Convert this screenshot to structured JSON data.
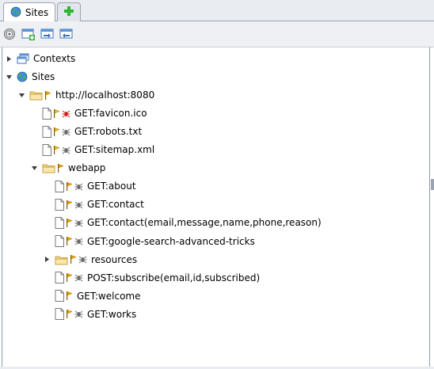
{
  "tabs": [
    {
      "label": "Sites",
      "icon": "globe-icon",
      "selected": true
    },
    {
      "label": "",
      "icon": "plus-icon",
      "selected": false
    }
  ],
  "toolbar": {
    "buttons": [
      {
        "icon": "target-icon"
      },
      {
        "icon": "new-context-icon"
      },
      {
        "icon": "import-context-icon"
      },
      {
        "icon": "export-context-icon"
      }
    ]
  },
  "tree": [
    {
      "label": "Contexts",
      "icon": "contexts-icon",
      "level": 0,
      "toggle": "collapsed"
    },
    {
      "label": "Sites",
      "icon": "globe-icon",
      "level": 0,
      "toggle": "expanded"
    },
    {
      "label": "http://localhost:8080",
      "icon": "folder",
      "level": 1,
      "toggle": "expanded",
      "flag": "orange",
      "spider": null
    },
    {
      "label": "GET:favicon.ico",
      "icon": "file",
      "level": 2,
      "toggle": null,
      "flag": "yellow",
      "spider": "red"
    },
    {
      "label": "GET:robots.txt",
      "icon": "file",
      "level": 2,
      "toggle": null,
      "flag": "yellow",
      "spider": "gray"
    },
    {
      "label": "GET:sitemap.xml",
      "icon": "file",
      "level": 2,
      "toggle": null,
      "flag": "yellow",
      "spider": "gray"
    },
    {
      "label": "webapp",
      "icon": "folder",
      "level": 2,
      "toggle": "expanded",
      "flag": "orange",
      "spider": null
    },
    {
      "label": "GET:about",
      "icon": "file",
      "level": 3,
      "toggle": null,
      "flag": "orange",
      "spider": "gray"
    },
    {
      "label": "GET:contact",
      "icon": "file",
      "level": 3,
      "toggle": null,
      "flag": "orange",
      "spider": "gray"
    },
    {
      "label": "GET:contact(email,message,name,phone,reason)",
      "icon": "file",
      "level": 3,
      "toggle": null,
      "flag": "orange",
      "spider": "gray"
    },
    {
      "label": "GET:google-search-advanced-tricks",
      "icon": "file",
      "level": 3,
      "toggle": null,
      "flag": "orange",
      "spider": "gray"
    },
    {
      "label": "resources",
      "icon": "folder",
      "level": 3,
      "toggle": "collapsed",
      "flag": "orange",
      "spider": "gray"
    },
    {
      "label": "POST:subscribe(email,id,subscribed)",
      "icon": "file",
      "level": 3,
      "toggle": null,
      "flag": "orange",
      "spider": "gray"
    },
    {
      "label": "GET:welcome",
      "icon": "file",
      "level": 3,
      "toggle": null,
      "flag": "orange",
      "spider": null
    },
    {
      "label": "GET:works",
      "icon": "file",
      "level": 3,
      "toggle": null,
      "flag": "orange",
      "spider": "gray"
    }
  ],
  "colors": {
    "flag_orange": "#f0a000",
    "flag_yellow": "#e8c800",
    "spider_red": "#d21e1e",
    "spider_gray": "#6a6a6a",
    "folder_fill": "#f6d88e",
    "folder_stroke": "#c8a040",
    "selection_border": "#9aa4b2"
  }
}
